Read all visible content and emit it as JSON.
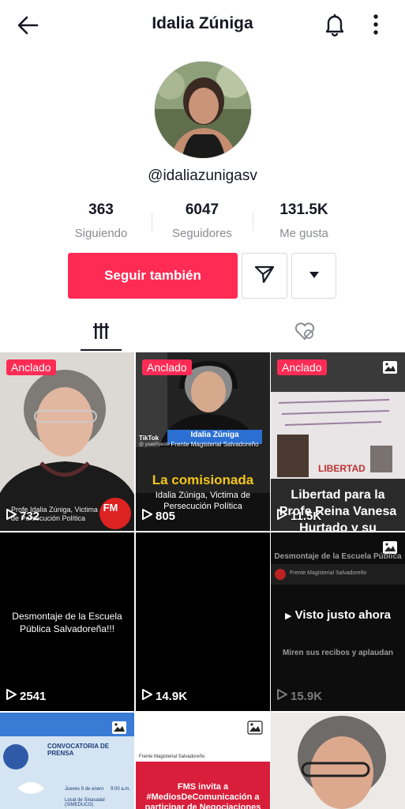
{
  "header": {
    "title": "Idalia Zúniga",
    "back_icon": "back-arrow-icon",
    "bell_icon": "bell-icon",
    "more_icon": "more-vertical-icon"
  },
  "profile": {
    "username": "@idaliazunigasv",
    "stats": [
      {
        "value": "363",
        "label": "Siguiendo"
      },
      {
        "value": "6047",
        "label": "Seguidores"
      },
      {
        "value": "131.5K",
        "label": "Me gusta"
      }
    ]
  },
  "actions": {
    "follow_label": "Seguir también",
    "message_icon": "send-message-icon",
    "dropdown_icon": "caret-down-icon"
  },
  "tabs": {
    "videos_icon": "grid-videos-icon",
    "liked_icon": "liked-hidden-icon"
  },
  "colors": {
    "accent": "#fe2c55",
    "text": "#161823",
    "muted": "#8a8b91"
  },
  "videos": [
    {
      "pinned": "Anclado",
      "views": "732",
      "caption": "Profe Idalia Zúniga, Victima de Persecución Política",
      "badge": "",
      "logo": "FM"
    },
    {
      "pinned": "Anclado",
      "views": "805",
      "caption_title": "La comisionada",
      "caption": "Idalia Zúniga, Victima de Persecución Política",
      "lower_third_name": "Idalia Zúniga",
      "lower_third_org": "Frente Magisterial Salvadoreño",
      "tiktok_tag": "TikTok",
      "handle": "@ yoakPoeste"
    },
    {
      "pinned": "Anclado",
      "views": "11.5K",
      "caption": "Libertad para la Profe Reina Vanesa Hurtado y su",
      "badge": "photo-icon",
      "banner_text": "LIBERTAD"
    },
    {
      "views": "2541",
      "caption": "Desmontaje de la Escuela Pública Salvadoreña!!!"
    },
    {
      "views": "14.9K",
      "caption": ""
    },
    {
      "views": "15.9K",
      "badge": "photo-icon",
      "header": "Desmontaje de la Escuela Pública",
      "post_author": "Frente Magisterial Salvadoreño",
      "overlay": "Visto justo ahora",
      "behind_text": "Miren sus recibos y aplaudan"
    },
    {
      "badge": "photo-icon",
      "title": "CONVOCATORIA DE PRENSA",
      "date": "Jueves 9 de enero",
      "time": "9:00 a.m.",
      "place": "Local de Sinasadal (SIMEDUCO)"
    },
    {
      "badge": "photo-icon",
      "org": "Frente Magisterial Salvadoreño",
      "caption": "FMS invita a #MediosDeComunicación a participar de Negociaciones"
    },
    {
      "caption": ""
    }
  ]
}
